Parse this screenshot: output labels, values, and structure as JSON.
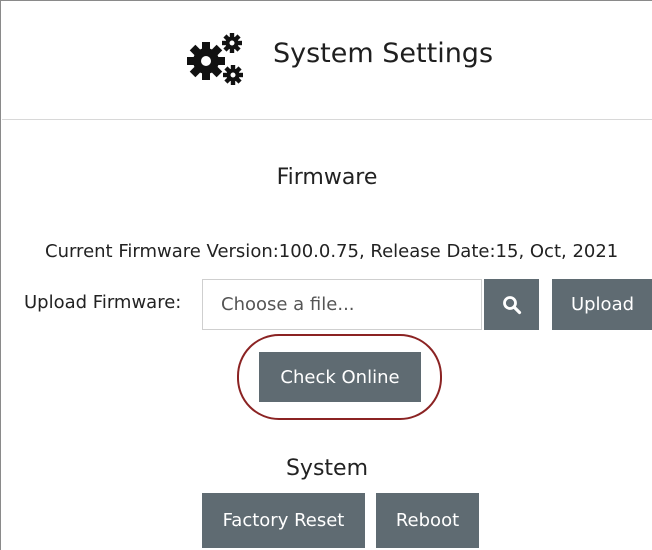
{
  "header": {
    "icon": "gears-icon",
    "title": "System Settings"
  },
  "firmware": {
    "heading": "Firmware",
    "info": "Current Firmware Version:100.0.75, Release Date:15, Oct, 2021",
    "upload_label": "Upload Firmware:",
    "file_placeholder": "Choose a file...",
    "search_icon": "search-icon",
    "upload_button": "Upload",
    "check_online_button": "Check Online"
  },
  "system": {
    "heading": "System",
    "factory_reset_button": "Factory Reset",
    "reboot_button": "Reboot"
  },
  "colors": {
    "button_bg": "#5f6b72",
    "highlight_ring": "#8b2323"
  }
}
